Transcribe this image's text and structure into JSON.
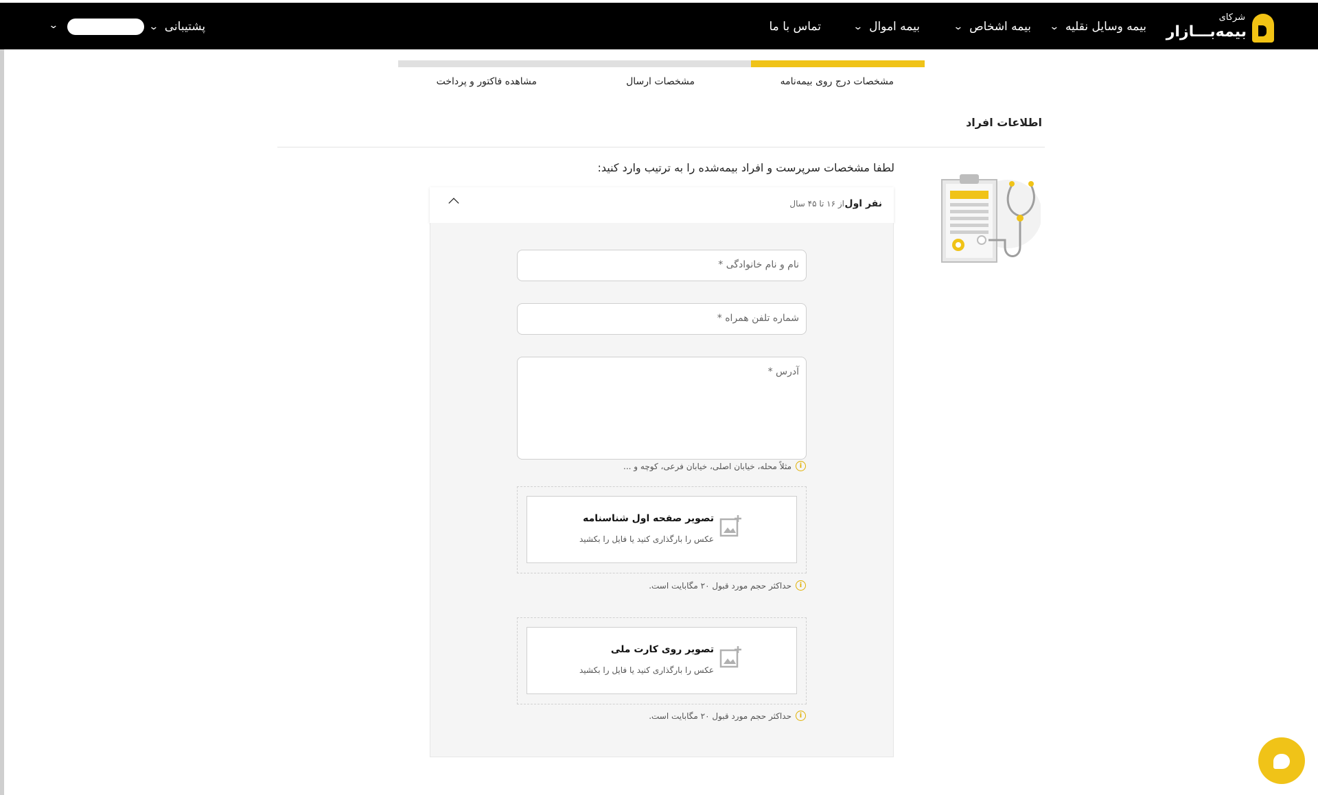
{
  "header": {
    "logo_line1": "شرکای",
    "logo_line2": "بیمه‌بـــازار",
    "nav": [
      {
        "label": "بیمه وسایل نقلیه"
      },
      {
        "label": "بیمه اشخاص"
      },
      {
        "label": "بیمه اموال"
      },
      {
        "label": "تماس با ما"
      }
    ],
    "support_label": "پشتیبانی"
  },
  "stepper": {
    "steps": [
      {
        "label": "مشخصات درج روی بیمه‌نامه",
        "active": true
      },
      {
        "label": "مشخصات ارسال",
        "active": false
      },
      {
        "label": "مشاهده فاکتور و پرداخت",
        "active": false
      }
    ],
    "progress_fraction": 0.33
  },
  "section": {
    "title": "اطلاعات افراد",
    "intro": "لطفا مشخصات سرپرست و افراد بیمه‌شده را به ترتیب وارد کنید:"
  },
  "person": {
    "title": "نفر اول",
    "age_range": "از ۱۶ تا ۴۵ سال",
    "fields": {
      "name_placeholder": "نام و نام خانوادگی *",
      "phone_placeholder": "شماره تلفن همراه *",
      "address_placeholder": "آدرس *",
      "address_hint": "مثلاً محله، خیابان اصلی، خیابان فرعی، کوچه و ..."
    },
    "uploads": [
      {
        "title": "تصویر صفحه اول شناسنامه",
        "subtitle": "عکس را بارگذاری کنید یا فایل را بکشید",
        "hint": "حداکثر حجم مورد قبول ۲۰ مگابایت است."
      },
      {
        "title": "تصویر روی کارت ملی",
        "subtitle": "عکس را بارگذاری کنید یا فایل را بکشید",
        "hint": "حداکثر حجم مورد قبول ۲۰ مگابایت است."
      }
    ]
  },
  "colors": {
    "accent": "#f0c318",
    "header_bg": "#000000"
  }
}
